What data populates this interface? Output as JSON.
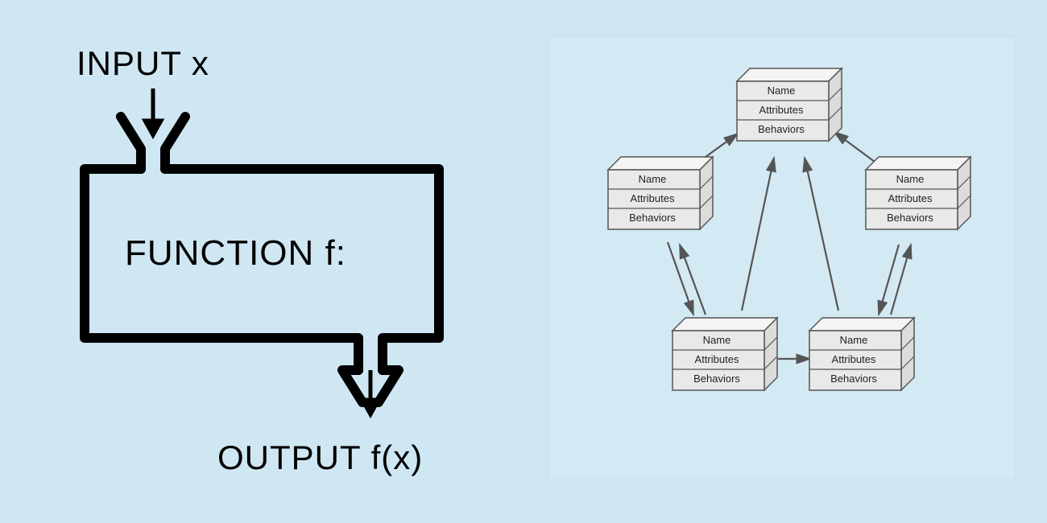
{
  "left": {
    "input_label": "INPUT x",
    "function_label": "FUNCTION f:",
    "output_label": "OUTPUT f(x)"
  },
  "cube_rows": {
    "name": "Name",
    "attributes": "Attributes",
    "behaviors": "Behaviors"
  },
  "colors": {
    "bg": "#cfe7f2",
    "panel": "#d3e9f3",
    "stroke": "#000000",
    "cube_face": "#e9e9e9",
    "cube_top": "#f4f4f4",
    "cube_line": "#555555"
  }
}
